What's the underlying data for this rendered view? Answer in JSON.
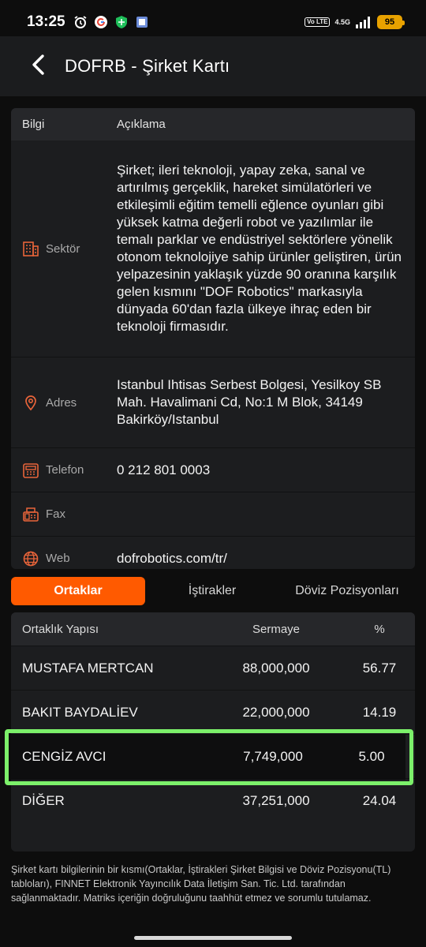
{
  "status": {
    "time": "13:25",
    "volte": "Vo LTE",
    "network": "4.5G",
    "battery": "95"
  },
  "header": {
    "title": "DOFRB - Şirket Kartı"
  },
  "info": {
    "col_label": "Bilgi",
    "col_desc": "Açıklama",
    "rows": [
      {
        "label": "Sektör",
        "value": "Şirket; ileri teknoloji, yapay zeka, sanal ve artırılmış gerçeklik, hareket simülatörleri ve etkileşimli eğitim temelli eğlence oyunları gibi yüksek katma değerli robot ve yazılımlar ile temalı parklar ve endüstriyel sektörlere yönelik otonom teknolojiye sahip ürünler geliştiren, ürün yelpazesinin yaklaşık yüzde 90 oranına karşılık gelen kısmını \"DOF Robotics\" markasıyla dünyada 60'dan fazla ülkeye ihraç eden bir teknoloji firmasıdır."
      },
      {
        "label": "Adres",
        "value": "Istanbul Ihtisas Serbest Bolgesi, Yesilkoy SB Mah. Havalimani Cd, No:1 M Blok, 34149 Bakirköy/Istanbul"
      },
      {
        "label": "Telefon",
        "value": "0 212 801 0003"
      },
      {
        "label": "Fax",
        "value": ""
      },
      {
        "label": "Web",
        "value": "dofrobotics.com/tr/"
      }
    ]
  },
  "tabs": [
    {
      "label": "Ortaklar"
    },
    {
      "label": "İştirakler"
    },
    {
      "label": "Döviz Pozisyonları"
    }
  ],
  "partners": {
    "col_name": "Ortaklık Yapısı",
    "col_capital": "Sermaye",
    "col_pct": "%",
    "rows": [
      {
        "name": "MUSTAFA MERTCAN",
        "capital": "88,000,000",
        "pct": "56.77"
      },
      {
        "name": "BAKIT BAYDALİEV",
        "capital": "22,000,000",
        "pct": "14.19"
      },
      {
        "name": "CENGİZ AVCI",
        "capital": "7,749,000",
        "pct": "5.00"
      },
      {
        "name": "DİĞER",
        "capital": "37,251,000",
        "pct": "24.04"
      }
    ]
  },
  "disclaimer": "Şirket kartı bilgilerinin bir kısmı(Ortaklar, İştirakleri Şirket Bilgisi ve Döviz Pozisyonu(TL) tabloları), FINNET Elektronik Yayıncılık Data İletişim San. Tic. Ltd. tarafından sağlanmaktadır. Matriks içeriğin doğruluğunu taahhüt etmez ve sorumlu tutulamaz.",
  "colors": {
    "accent": "#ff5a00",
    "highlight": "#7cf06a",
    "icon": "#e8643a"
  }
}
